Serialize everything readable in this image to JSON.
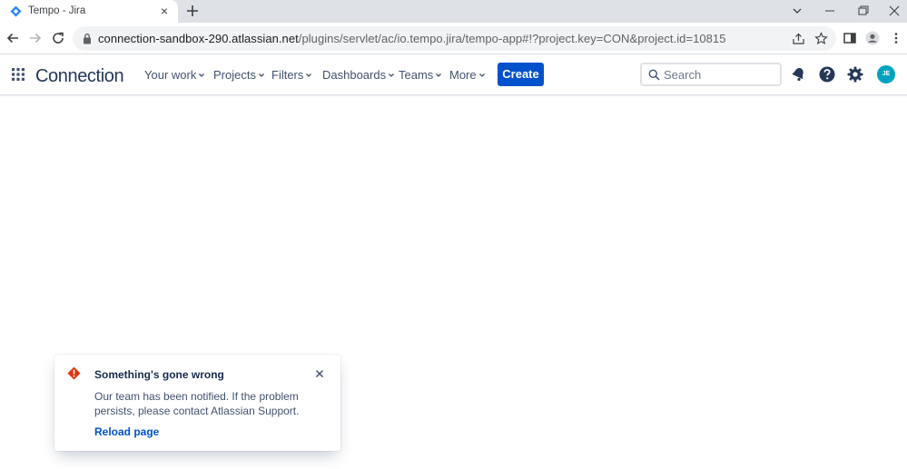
{
  "browser": {
    "tab_title": "Tempo - Jira",
    "tab_close_icon": "×",
    "url_host": "connection-sandbox-290.atlassian.net",
    "url_path": "/plugins/servlet/ac/io.tempo.jira/tempo-app#!?project.key=CON&project.id=10815"
  },
  "nav": {
    "logo": "Connection",
    "items": [
      {
        "label": "Your work"
      },
      {
        "label": "Projects"
      },
      {
        "label": "Filters"
      },
      {
        "label": "Dashboards"
      },
      {
        "label": "Teams"
      },
      {
        "label": "More"
      }
    ],
    "create_label": "Create",
    "search_placeholder": "Search",
    "avatar_initials": "JE"
  },
  "flag": {
    "title": "Something's gone wrong",
    "description": "Our team has been notified. If the problem persists, please contact Atlassian Support.",
    "action": "Reload page"
  },
  "colors": {
    "brand_blue": "#0052cc",
    "error_red": "#de350b",
    "avatar_teal": "#00a3bf"
  }
}
